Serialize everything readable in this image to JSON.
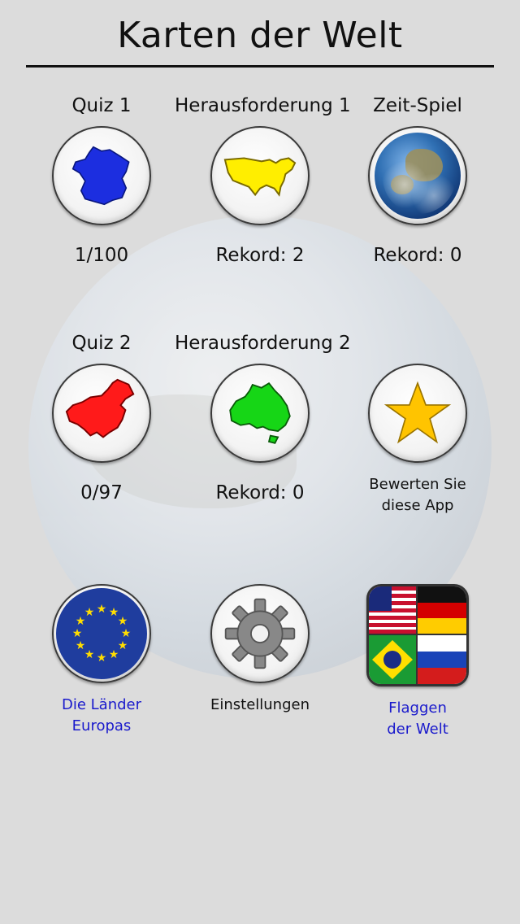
{
  "header": {
    "title": "Karten der Welt"
  },
  "row1": [
    {
      "label": "Quiz 1",
      "stat": "1/100",
      "icon": "france-map-icon",
      "color": "#1c2ee0"
    },
    {
      "label": "Herausforderung 1",
      "stat": "Rekord: 2",
      "icon": "usa-map-icon",
      "color": "#ffee00"
    },
    {
      "label": "Zeit-Spiel",
      "stat": "Rekord: 0",
      "icon": "earth-globe-icon"
    }
  ],
  "row2": [
    {
      "label": "Quiz 2",
      "stat": "0/97",
      "icon": "china-map-icon",
      "color": "#ff1a1a"
    },
    {
      "label": "Herausforderung 2",
      "stat": "Rekord: 0",
      "icon": "australia-map-icon",
      "color": "#16d616"
    },
    {
      "line1": "Bewerten Sie",
      "line2": "diese App",
      "icon": "star-icon",
      "color": "#ffc400"
    }
  ],
  "row3": [
    {
      "line1": "Die Länder",
      "line2": "Europas",
      "icon": "eu-flag-icon",
      "link_color": "#1a1acc"
    },
    {
      "line1": "Einstellungen",
      "icon": "gear-icon"
    },
    {
      "line1": "Flaggen",
      "line2": "der Welt",
      "icon": "world-flags-icon",
      "link_color": "#1a1acc"
    }
  ]
}
